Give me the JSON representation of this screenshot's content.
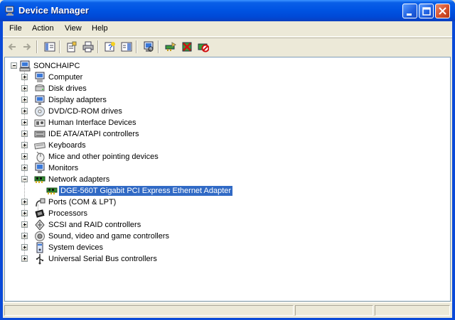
{
  "window": {
    "title": "Device Manager"
  },
  "menu": [
    "File",
    "Action",
    "View",
    "Help"
  ],
  "toolbar": {
    "buttons": [
      "back-icon",
      "forward-icon",
      "show-hide-tree-icon",
      "properties-icon",
      "print-icon",
      "help-icon",
      "show-hide-pane-icon",
      "scan-hardware-icon",
      "update-driver-icon",
      "uninstall-icon",
      "disable-icon"
    ]
  },
  "tree": {
    "root": "SONCHAIPC",
    "items": [
      {
        "label": "Computer",
        "icon": "computer-icon"
      },
      {
        "label": "Disk drives",
        "icon": "disk-drive-icon"
      },
      {
        "label": "Display adapters",
        "icon": "display-adapter-icon"
      },
      {
        "label": "DVD/CD-ROM drives",
        "icon": "dvd-drive-icon"
      },
      {
        "label": "Human Interface Devices",
        "icon": "hid-icon"
      },
      {
        "label": "IDE ATA/ATAPI controllers",
        "icon": "ide-controller-icon"
      },
      {
        "label": "Keyboards",
        "icon": "keyboard-icon"
      },
      {
        "label": "Mice and other pointing devices",
        "icon": "mouse-icon"
      },
      {
        "label": "Monitors",
        "icon": "monitor-icon"
      },
      {
        "label": "Network adapters",
        "icon": "network-adapter-icon",
        "expanded": true
      },
      {
        "label": "Ports (COM & LPT)",
        "icon": "port-icon"
      },
      {
        "label": "Processors",
        "icon": "processor-icon"
      },
      {
        "label": "SCSI and RAID controllers",
        "icon": "scsi-icon"
      },
      {
        "label": "Sound, video and game controllers",
        "icon": "sound-icon"
      },
      {
        "label": "System devices",
        "icon": "system-device-icon"
      },
      {
        "label": "Universal Serial Bus controllers",
        "icon": "usb-icon"
      }
    ],
    "child": {
      "label": "DGE-560T Gigabit PCI Express Ethernet Adapter",
      "icon": "network-adapter-icon",
      "selected": true
    }
  },
  "colors": {
    "titlebar": "#0054e3",
    "selection": "#316ac5",
    "close": "#d5502b"
  }
}
